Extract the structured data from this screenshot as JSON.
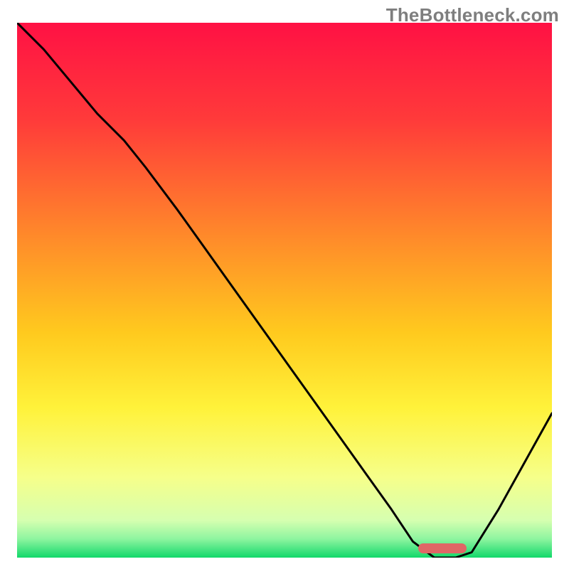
{
  "watermark": "TheBottleneck.com",
  "chart_data": {
    "type": "line",
    "x": [
      0.0,
      0.05,
      0.1,
      0.15,
      0.2,
      0.24,
      0.3,
      0.35,
      0.4,
      0.45,
      0.5,
      0.55,
      0.6,
      0.65,
      0.7,
      0.74,
      0.78,
      0.82,
      0.85,
      0.9,
      0.95,
      1.0
    ],
    "values": [
      100,
      95,
      89,
      83,
      78,
      73,
      65,
      58,
      51,
      44,
      37,
      30,
      23,
      16,
      9,
      3,
      0,
      0,
      1,
      9,
      18,
      27
    ],
    "title": "",
    "xlabel": "",
    "ylabel": "",
    "xlim": [
      0,
      1
    ],
    "ylim": [
      0,
      100
    ],
    "indicator_range_x": [
      0.75,
      0.84
    ],
    "background_gradient": {
      "stops": [
        {
          "offset": 0.0,
          "color": "#ff1144"
        },
        {
          "offset": 0.18,
          "color": "#ff3a3a"
        },
        {
          "offset": 0.4,
          "color": "#ff8a2a"
        },
        {
          "offset": 0.58,
          "color": "#ffca1e"
        },
        {
          "offset": 0.72,
          "color": "#fff23a"
        },
        {
          "offset": 0.85,
          "color": "#f6ff8a"
        },
        {
          "offset": 0.93,
          "color": "#d6ffb0"
        },
        {
          "offset": 0.965,
          "color": "#8ef5a0"
        },
        {
          "offset": 1.0,
          "color": "#12d86a"
        }
      ]
    }
  }
}
